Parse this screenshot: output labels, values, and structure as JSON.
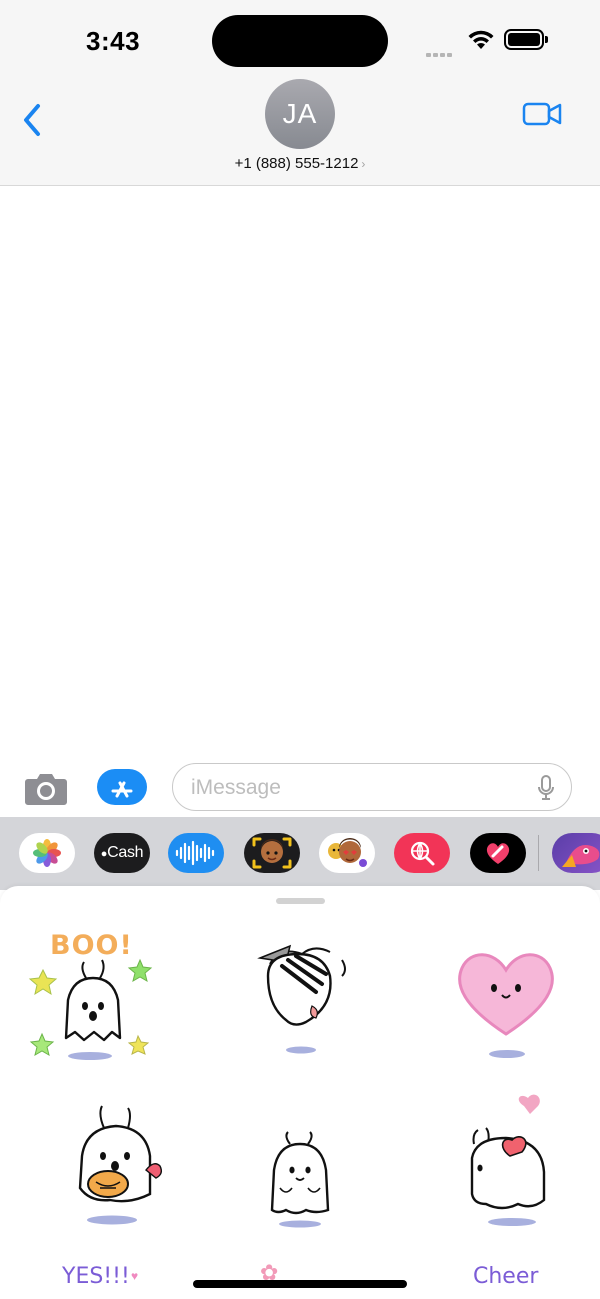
{
  "status_bar": {
    "time": "3:43"
  },
  "header": {
    "avatar_initials": "JA",
    "contact_phone": "+1 (888) 555-1212",
    "contact_chevron": "›",
    "back_icon": "chevron-left-icon",
    "video_icon": "video-camera-icon"
  },
  "composer": {
    "placeholder": "iMessage",
    "camera_icon": "camera-icon",
    "apps_icon": "app-store-icon",
    "mic_icon": "microphone-icon"
  },
  "app_strip": {
    "apps": [
      "Photos",
      "Cash",
      "Audio",
      "Memoji",
      "Memoji Stickers",
      "Search",
      "Digital Touch",
      "Sticker App"
    ],
    "cash_label": "Cash"
  },
  "stickers": {
    "labels": {
      "boo": "BOO!",
      "yes": "YES!!!",
      "cheer": "Cheer"
    }
  },
  "colors": {
    "accent": "#1b8df5",
    "sticker_text": "#7b5cd6"
  }
}
